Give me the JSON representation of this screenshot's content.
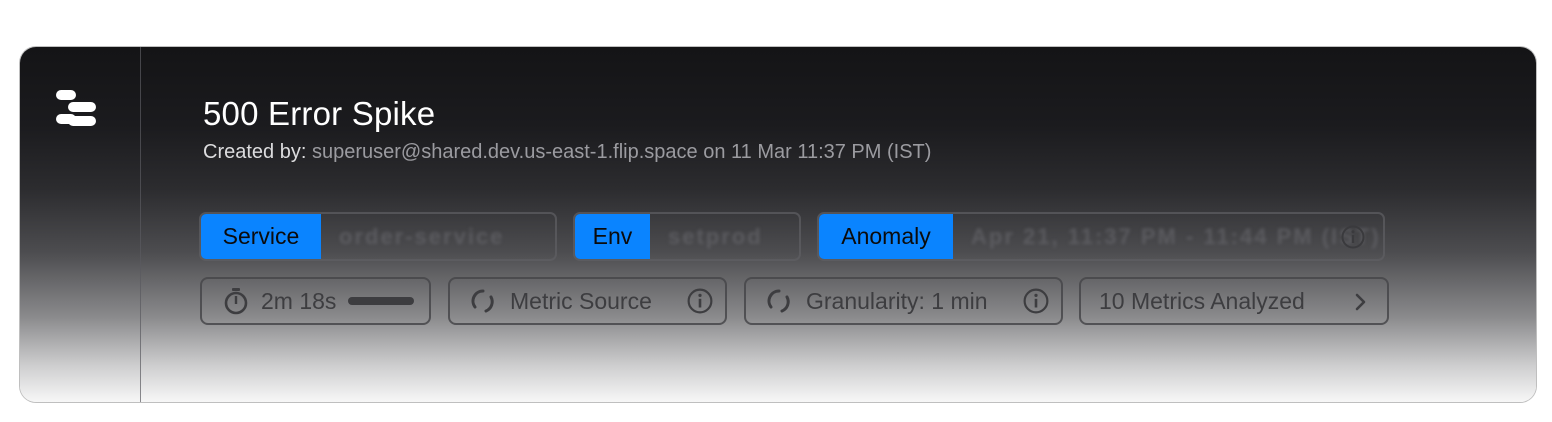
{
  "header": {
    "title": "500 Error Spike",
    "created_by_label": "Created by:",
    "created_by_value": "superuser@shared.dev.us-east-1.flip.space on 11 Mar 11:37 PM (IST)"
  },
  "tags": {
    "service": {
      "key": "Service",
      "value": "order-service"
    },
    "env": {
      "key": "Env",
      "value": "setprod"
    },
    "anomaly": {
      "key": "Anomaly",
      "value": "Apr 21, 11:37 PM - 11:44 PM (IST)"
    }
  },
  "pills": {
    "timer": "2m 18s",
    "metric_source": "Metric Source",
    "granularity": "Granularity: 1 min",
    "metrics_analyzed": "10 Metrics Analyzed"
  },
  "colors": {
    "accent": "#0a84ff",
    "title": "#ffffff",
    "subtle": "#9b9ba0"
  },
  "icons": [
    "logo-icon",
    "info-icon",
    "stopwatch-icon",
    "loading-spinner-icon",
    "chevron-right-icon"
  ]
}
